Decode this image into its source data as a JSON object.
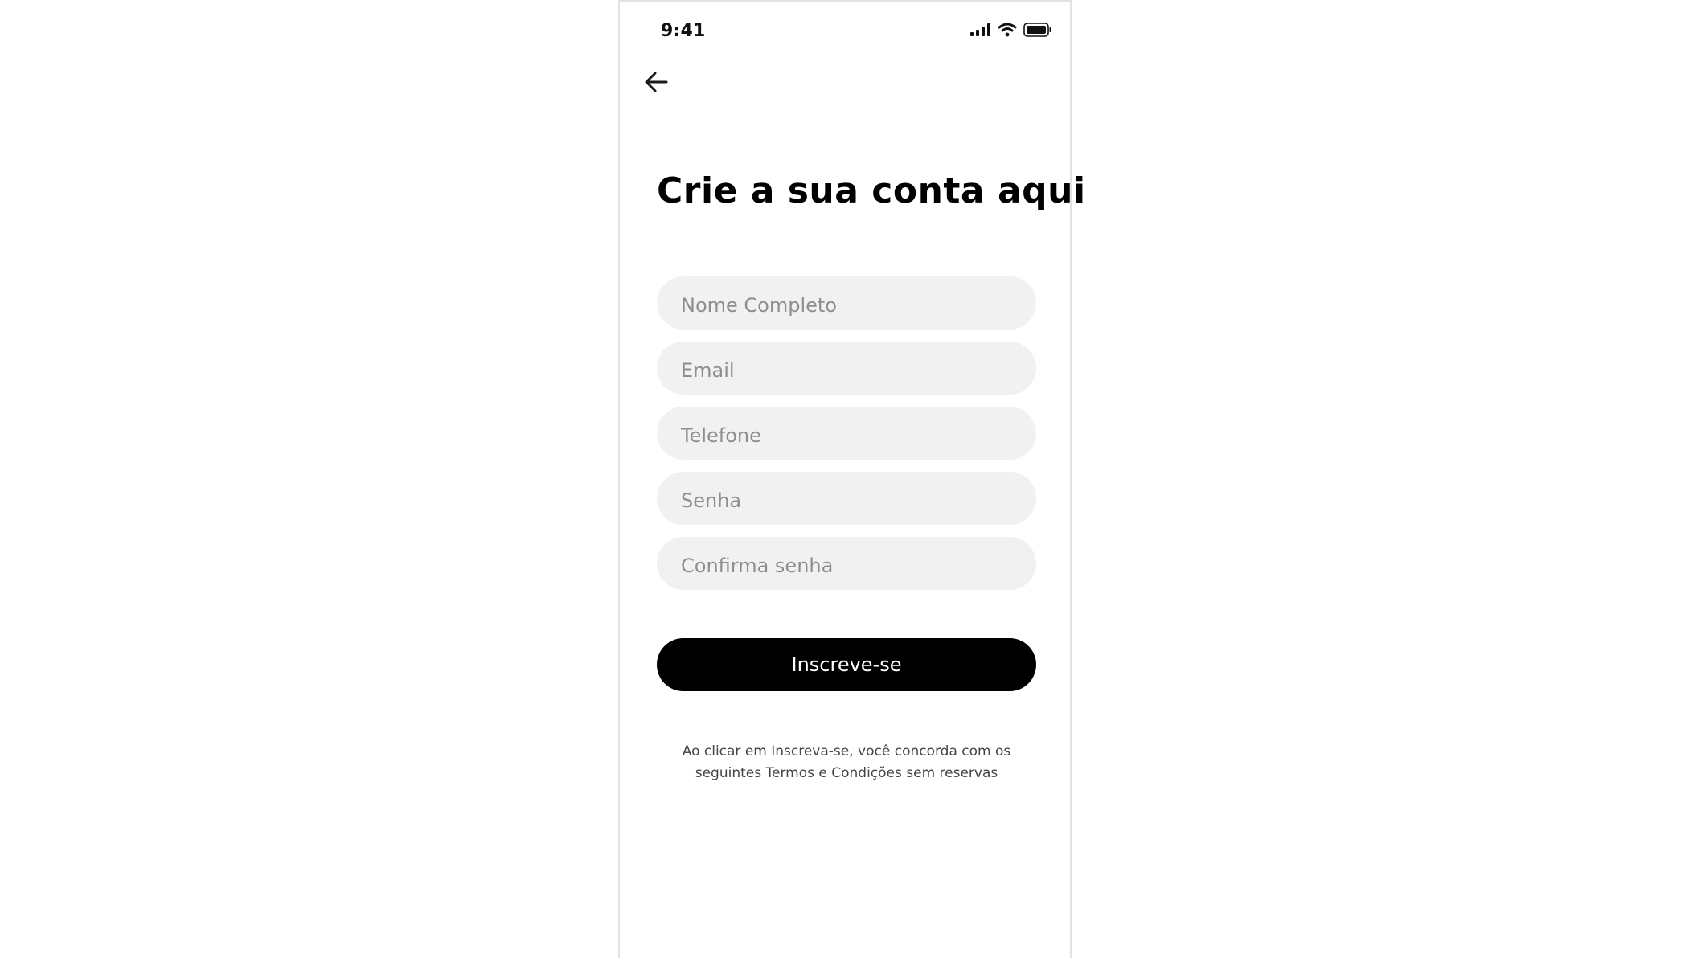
{
  "status_bar": {
    "time": "9:41",
    "icons": [
      "signal-icon",
      "wifi-icon",
      "battery-icon"
    ]
  },
  "header": {
    "back_icon": "arrow-left-icon"
  },
  "title": "Crie a sua conta aqui",
  "form": {
    "fields": [
      {
        "name": "full-name",
        "placeholder": "Nome Completo",
        "value": ""
      },
      {
        "name": "email",
        "placeholder": "Email",
        "value": ""
      },
      {
        "name": "phone",
        "placeholder": "Telefone",
        "value": ""
      },
      {
        "name": "password",
        "placeholder": "Senha",
        "value": ""
      },
      {
        "name": "confirm-password",
        "placeholder": "Confirma senha",
        "value": ""
      }
    ],
    "submit_label": "Inscreve-se"
  },
  "terms": {
    "line1": "Ao clicar em Inscreva-se, você concorda com os",
    "line2": "seguintes Termos e Condições sem reservas"
  },
  "colors": {
    "button_bg": "#000000",
    "field_bg": "#f1f1f1",
    "placeholder": "#8e8e8e"
  }
}
